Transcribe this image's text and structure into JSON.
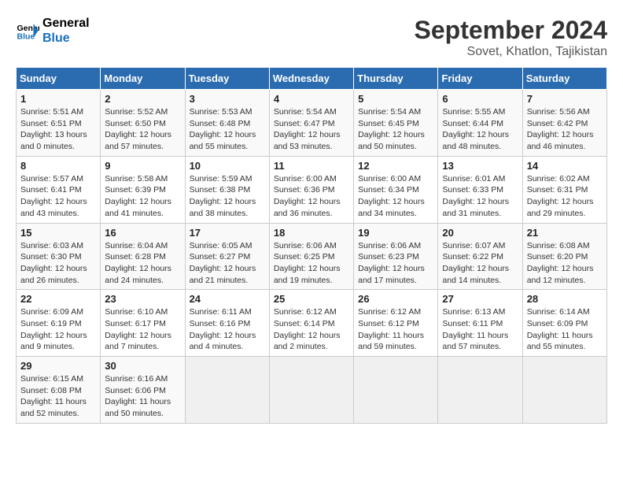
{
  "header": {
    "logo_line1": "General",
    "logo_line2": "Blue",
    "month": "September 2024",
    "location": "Sovet, Khatlon, Tajikistan"
  },
  "days_of_week": [
    "Sunday",
    "Monday",
    "Tuesday",
    "Wednesday",
    "Thursday",
    "Friday",
    "Saturday"
  ],
  "weeks": [
    [
      {
        "day": "1",
        "info": "Sunrise: 5:51 AM\nSunset: 6:51 PM\nDaylight: 13 hours\nand 0 minutes."
      },
      {
        "day": "2",
        "info": "Sunrise: 5:52 AM\nSunset: 6:50 PM\nDaylight: 12 hours\nand 57 minutes."
      },
      {
        "day": "3",
        "info": "Sunrise: 5:53 AM\nSunset: 6:48 PM\nDaylight: 12 hours\nand 55 minutes."
      },
      {
        "day": "4",
        "info": "Sunrise: 5:54 AM\nSunset: 6:47 PM\nDaylight: 12 hours\nand 53 minutes."
      },
      {
        "day": "5",
        "info": "Sunrise: 5:54 AM\nSunset: 6:45 PM\nDaylight: 12 hours\nand 50 minutes."
      },
      {
        "day": "6",
        "info": "Sunrise: 5:55 AM\nSunset: 6:44 PM\nDaylight: 12 hours\nand 48 minutes."
      },
      {
        "day": "7",
        "info": "Sunrise: 5:56 AM\nSunset: 6:42 PM\nDaylight: 12 hours\nand 46 minutes."
      }
    ],
    [
      {
        "day": "8",
        "info": "Sunrise: 5:57 AM\nSunset: 6:41 PM\nDaylight: 12 hours\nand 43 minutes."
      },
      {
        "day": "9",
        "info": "Sunrise: 5:58 AM\nSunset: 6:39 PM\nDaylight: 12 hours\nand 41 minutes."
      },
      {
        "day": "10",
        "info": "Sunrise: 5:59 AM\nSunset: 6:38 PM\nDaylight: 12 hours\nand 38 minutes."
      },
      {
        "day": "11",
        "info": "Sunrise: 6:00 AM\nSunset: 6:36 PM\nDaylight: 12 hours\nand 36 minutes."
      },
      {
        "day": "12",
        "info": "Sunrise: 6:00 AM\nSunset: 6:34 PM\nDaylight: 12 hours\nand 34 minutes."
      },
      {
        "day": "13",
        "info": "Sunrise: 6:01 AM\nSunset: 6:33 PM\nDaylight: 12 hours\nand 31 minutes."
      },
      {
        "day": "14",
        "info": "Sunrise: 6:02 AM\nSunset: 6:31 PM\nDaylight: 12 hours\nand 29 minutes."
      }
    ],
    [
      {
        "day": "15",
        "info": "Sunrise: 6:03 AM\nSunset: 6:30 PM\nDaylight: 12 hours\nand 26 minutes."
      },
      {
        "day": "16",
        "info": "Sunrise: 6:04 AM\nSunset: 6:28 PM\nDaylight: 12 hours\nand 24 minutes."
      },
      {
        "day": "17",
        "info": "Sunrise: 6:05 AM\nSunset: 6:27 PM\nDaylight: 12 hours\nand 21 minutes."
      },
      {
        "day": "18",
        "info": "Sunrise: 6:06 AM\nSunset: 6:25 PM\nDaylight: 12 hours\nand 19 minutes."
      },
      {
        "day": "19",
        "info": "Sunrise: 6:06 AM\nSunset: 6:23 PM\nDaylight: 12 hours\nand 17 minutes."
      },
      {
        "day": "20",
        "info": "Sunrise: 6:07 AM\nSunset: 6:22 PM\nDaylight: 12 hours\nand 14 minutes."
      },
      {
        "day": "21",
        "info": "Sunrise: 6:08 AM\nSunset: 6:20 PM\nDaylight: 12 hours\nand 12 minutes."
      }
    ],
    [
      {
        "day": "22",
        "info": "Sunrise: 6:09 AM\nSunset: 6:19 PM\nDaylight: 12 hours\nand 9 minutes."
      },
      {
        "day": "23",
        "info": "Sunrise: 6:10 AM\nSunset: 6:17 PM\nDaylight: 12 hours\nand 7 minutes."
      },
      {
        "day": "24",
        "info": "Sunrise: 6:11 AM\nSunset: 6:16 PM\nDaylight: 12 hours\nand 4 minutes."
      },
      {
        "day": "25",
        "info": "Sunrise: 6:12 AM\nSunset: 6:14 PM\nDaylight: 12 hours\nand 2 minutes."
      },
      {
        "day": "26",
        "info": "Sunrise: 6:12 AM\nSunset: 6:12 PM\nDaylight: 11 hours\nand 59 minutes."
      },
      {
        "day": "27",
        "info": "Sunrise: 6:13 AM\nSunset: 6:11 PM\nDaylight: 11 hours\nand 57 minutes."
      },
      {
        "day": "28",
        "info": "Sunrise: 6:14 AM\nSunset: 6:09 PM\nDaylight: 11 hours\nand 55 minutes."
      }
    ],
    [
      {
        "day": "29",
        "info": "Sunrise: 6:15 AM\nSunset: 6:08 PM\nDaylight: 11 hours\nand 52 minutes."
      },
      {
        "day": "30",
        "info": "Sunrise: 6:16 AM\nSunset: 6:06 PM\nDaylight: 11 hours\nand 50 minutes."
      },
      {
        "day": "",
        "info": ""
      },
      {
        "day": "",
        "info": ""
      },
      {
        "day": "",
        "info": ""
      },
      {
        "day": "",
        "info": ""
      },
      {
        "day": "",
        "info": ""
      }
    ]
  ]
}
